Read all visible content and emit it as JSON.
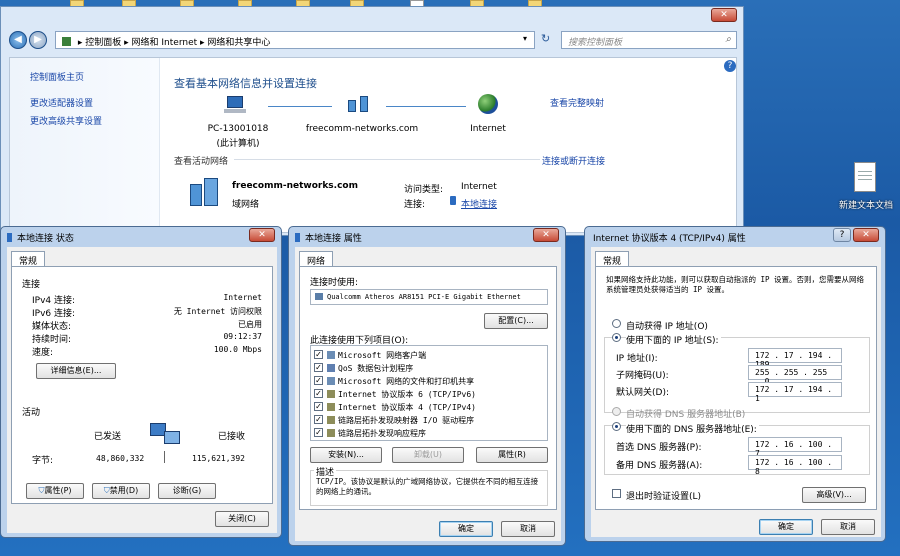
{
  "desktop": {
    "icon_label": "新建文本文档"
  },
  "main_window": {
    "address": {
      "crumb1": "控制面板",
      "crumb2": "网络和 Internet",
      "crumb3": "网络和共享中心"
    },
    "search_placeholder": "搜索控制面板",
    "left_pane": {
      "home": "控制面板主页",
      "adapter": "更改适配器设置",
      "sharing": "更改高级共享设置"
    },
    "heading": "查看基本网络信息并设置连接",
    "map_link": "查看完整映射",
    "nodes": {
      "pc": "PC-13001018",
      "pc_sub": "(此计算机)",
      "network": "freecomm-networks.com",
      "internet": "Internet"
    },
    "active_label": "查看活动网络",
    "connect_link": "连接或断开连接",
    "active": {
      "name": "freecomm-networks.com",
      "type": "域网络",
      "access_label": "访问类型:",
      "access_value": "Internet",
      "conn_label": "连接:",
      "conn_value": "本地连接"
    }
  },
  "status_dialog": {
    "title": "本地连接 状态",
    "tab": "常规",
    "section_conn": "连接",
    "rows": [
      {
        "label": "IPv4 连接:",
        "value": "Internet"
      },
      {
        "label": "IPv6 连接:",
        "value": "无 Internet 访问权限"
      },
      {
        "label": "媒体状态:",
        "value": "已启用"
      },
      {
        "label": "持续时间:",
        "value": "09:12:37"
      },
      {
        "label": "速度:",
        "value": "100.0 Mbps"
      }
    ],
    "details_btn": "详细信息(E)...",
    "section_activity": "活动",
    "sent": "已发送",
    "received": "已接收",
    "bytes_label": "字节:",
    "bytes_sent": "48,860,332",
    "bytes_received": "115,621,392",
    "properties_btn": "属性(P)",
    "disable_btn": "禁用(D)",
    "diagnose_btn": "诊断(G)",
    "close_btn": "关闭(C)"
  },
  "props_dialog": {
    "title": "本地连接 属性",
    "tab": "网络",
    "connect_using": "连接时使用:",
    "adapter": "Qualcomm Atheros AR8151 PCI-E Gigabit Ethernet",
    "configure_btn": "配置(C)...",
    "items_label": "此连接使用下列项目(O):",
    "items": [
      "Microsoft 网络客户端",
      "QoS 数据包计划程序",
      "Microsoft 网络的文件和打印机共享",
      "Internet 协议版本 6 (TCP/IPv6)",
      "Internet 协议版本 4 (TCP/IPv4)",
      "链路层拓扑发现映射器 I/O 驱动程序",
      "链路层拓扑发现响应程序"
    ],
    "install_btn": "安装(N)...",
    "uninstall_btn": "卸载(U)",
    "properties_btn": "属性(R)",
    "desc_label": "描述",
    "desc_text": "TCP/IP。该协议是默认的广域网络协议，它提供在不同的相互连接的网络上的通讯。",
    "ok_btn": "确定",
    "cancel_btn": "取消"
  },
  "ipv4_dialog": {
    "title": "Internet 协议版本 4 (TCP/IPv4) 属性",
    "tab": "常规",
    "intro": "如果网络支持此功能，则可以获取自动指派的 IP 设置。否则，您需要从网络系统管理员处获得适当的 IP 设置。",
    "auto_ip": "自动获得 IP 地址(O)",
    "manual_ip": "使用下面的 IP 地址(S):",
    "ip_label": "IP 地址(I):",
    "ip_value": "172 . 17 . 194 . 189",
    "mask_label": "子网掩码(U):",
    "mask_value": "255 . 255 . 255 . 0",
    "gw_label": "默认网关(D):",
    "gw_value": "172 . 17 . 194 . 1",
    "auto_dns": "自动获得 DNS 服务器地址(B)",
    "manual_dns": "使用下面的 DNS 服务器地址(E):",
    "dns1_label": "首选 DNS 服务器(P):",
    "dns1_value": "172 . 16 . 100 . 7",
    "dns2_label": "备用 DNS 服务器(A):",
    "dns2_value": "172 . 16 . 100 . 8",
    "validate": "退出时验证设置(L)",
    "advanced_btn": "高级(V)...",
    "ok_btn": "确定",
    "cancel_btn": "取消"
  }
}
